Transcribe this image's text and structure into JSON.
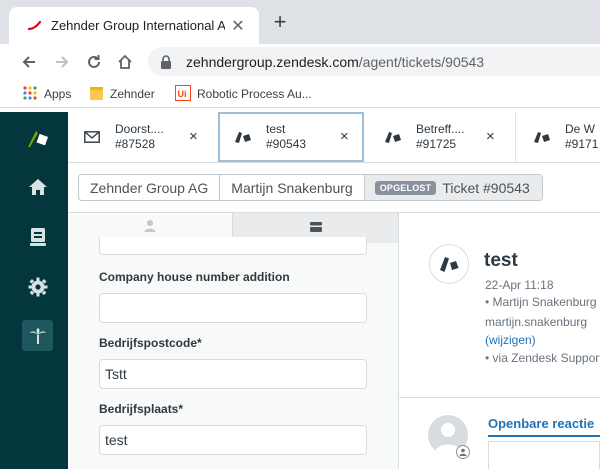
{
  "browser": {
    "tab_title": "Zehnder Group International AG",
    "url_host": "zehndergroup.zendesk.com",
    "url_path": "/agent/tickets/90543",
    "bookmarks": [
      {
        "label": "Apps"
      },
      {
        "label": "Zehnder"
      },
      {
        "label": "Robotic Process Au..."
      }
    ]
  },
  "zendesk": {
    "open_tabs": [
      {
        "title": "Doorst....",
        "subtitle": "#87528"
      },
      {
        "title": "test",
        "subtitle": "#90543"
      },
      {
        "title": "Betreff....",
        "subtitle": "#91725"
      },
      {
        "title": "De W",
        "subtitle": "#9171"
      }
    ],
    "breadcrumb": {
      "organization": "Zehnder Group AG",
      "requester": "Martijn Snakenburg",
      "status_badge": "OPGELOST",
      "ticket": "Ticket #90543"
    },
    "form": {
      "company_house_number_addition_label": "Company house number addition",
      "company_house_number_addition_value": "",
      "postcode_label": "Bedrijfspostcode*",
      "postcode_value": "Tstt",
      "city_label": "Bedrijfsplaats*",
      "city_value": "test"
    },
    "conversation": {
      "title": "test",
      "timestamp": "22-Apr 11:18",
      "requester_line": "• Martijn Snakenburg",
      "email_line": "martijn.snakenburg",
      "change_link": "(wijzigen)",
      "via_line": "• via Zendesk Support"
    },
    "reply": {
      "public_reply_label": "Openbare reactie"
    }
  },
  "colors": {
    "nav_bg": "#03363d",
    "accent_green": "#78a300",
    "link_blue": "#1f73b7",
    "active_tab_border": "#9fbfd8",
    "solved_badge": "#87929d"
  },
  "icons": [
    "zehnder-favicon",
    "plus-icon",
    "back-arrow-icon",
    "forward-arrow-icon",
    "reload-icon",
    "home-icon",
    "lock-icon",
    "apps-grid-icon",
    "folder-icon",
    "uipath-icon",
    "zendesk-logo",
    "views-icon",
    "settings-gear-icon",
    "apps-palm-icon",
    "mail-icon",
    "ticket-icon",
    "user-icon",
    "organization-icon"
  ]
}
